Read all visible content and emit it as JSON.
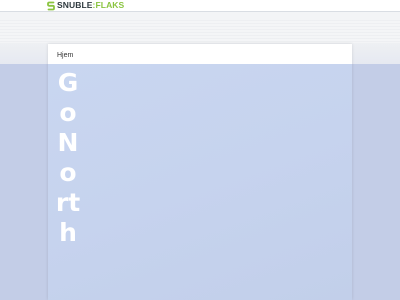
{
  "brand": {
    "name_part1": "SNUBLE",
    "separator": ":",
    "name_part2": "FLAKS",
    "icon": "s-logo-icon",
    "colors": {
      "dark": "#2f3a3f",
      "green": "#8ac43f"
    }
  },
  "breadcrumb": {
    "home_label": "Hjem"
  },
  "hero": {
    "title": "GoNorth"
  }
}
